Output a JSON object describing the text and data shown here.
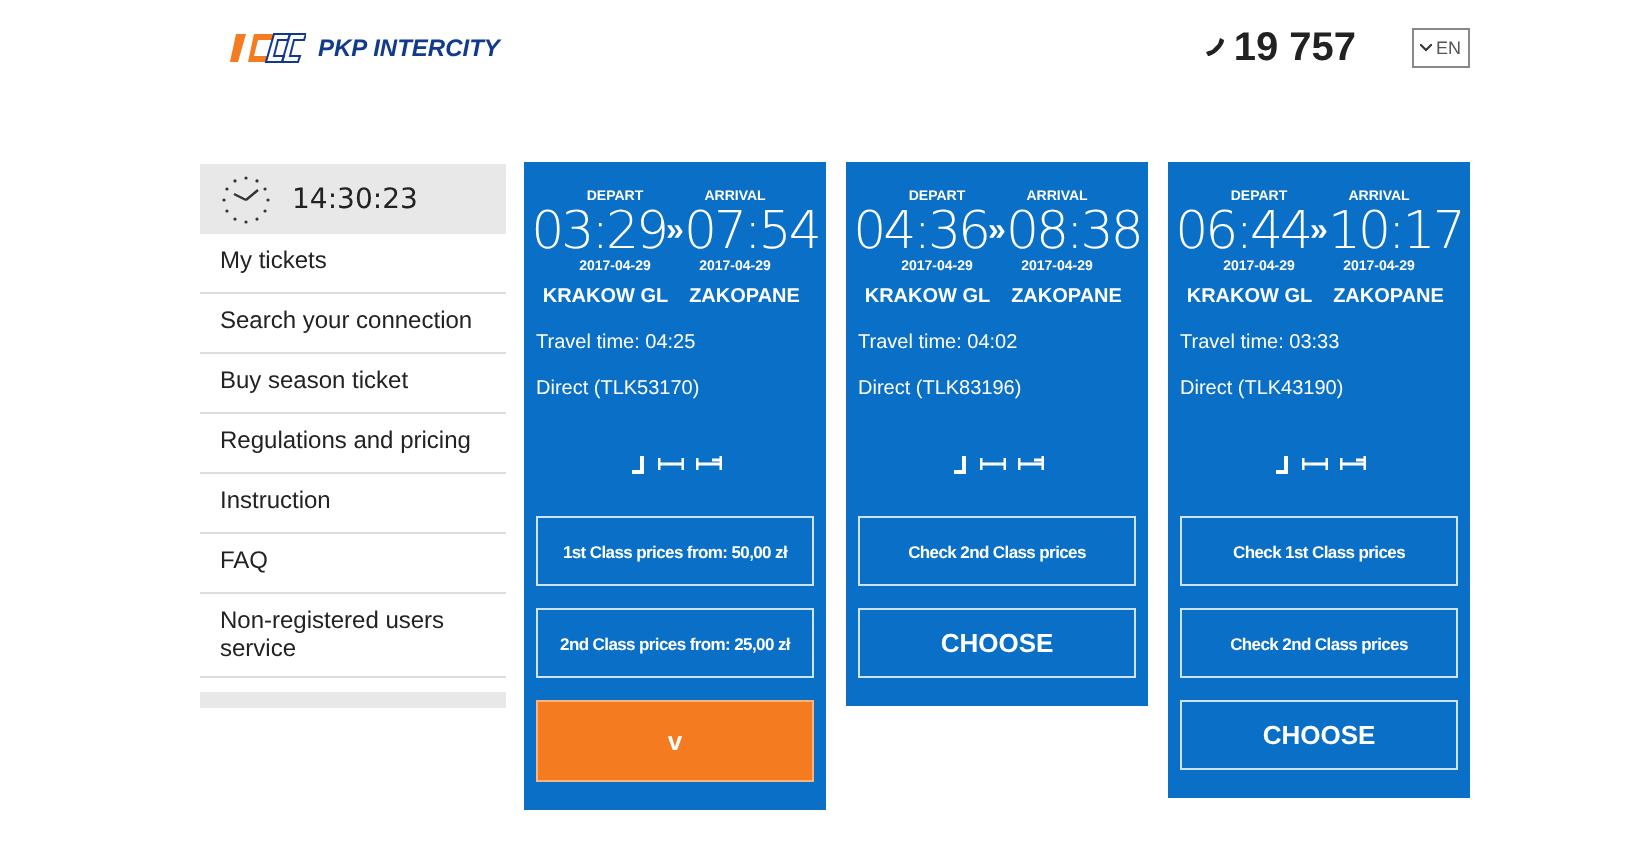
{
  "header": {
    "logo_text": "PKP INTERCITY",
    "phone": "19 757",
    "language": "EN"
  },
  "sidebar": {
    "clock": "14:30:23",
    "items": [
      {
        "label": "My tickets"
      },
      {
        "label": "Search your connection"
      },
      {
        "label": "Buy season ticket"
      },
      {
        "label": "Regulations and pricing"
      },
      {
        "label": "Instruction"
      },
      {
        "label": "FAQ"
      },
      {
        "label": "Non-registered users service"
      }
    ]
  },
  "connections": [
    {
      "depart_label": "DEPART",
      "arrival_label": "ARRIVAL",
      "depart_time": "03:29",
      "separator": "»",
      "arrival_time": "07:54",
      "depart_date": "2017-04-29",
      "arrival_date": "2017-04-29",
      "from": "KRAKOW GL",
      "to": "ZAKOPANE",
      "travel_time": "Travel time: 04:25",
      "train": "Direct (TLK53170)",
      "buttons": [
        {
          "kind": "price",
          "label": "1st Class prices from: 50,00 zł"
        },
        {
          "kind": "price",
          "label": "2nd Class prices from: 25,00 zł"
        },
        {
          "kind": "expand",
          "label": "v"
        }
      ]
    },
    {
      "depart_label": "DEPART",
      "arrival_label": "ARRIVAL",
      "depart_time": "04:36",
      "separator": "»",
      "arrival_time": "08:38",
      "depart_date": "2017-04-29",
      "arrival_date": "2017-04-29",
      "from": "KRAKOW GL",
      "to": "ZAKOPANE",
      "travel_time": "Travel time: 04:02",
      "train": "Direct (TLK83196)",
      "buttons": [
        {
          "kind": "price",
          "label": "Check 2nd Class prices"
        },
        {
          "kind": "choose",
          "label": "CHOOSE"
        }
      ]
    },
    {
      "depart_label": "DEPART",
      "arrival_label": "ARRIVAL",
      "depart_time": "06:44",
      "separator": "»",
      "arrival_time": "10:17",
      "depart_date": "2017-04-29",
      "arrival_date": "2017-04-29",
      "from": "KRAKOW GL",
      "to": "ZAKOPANE",
      "travel_time": "Travel time: 03:33",
      "train": "Direct (TLK43190)",
      "buttons": [
        {
          "kind": "price",
          "label": "Check 1st Class prices"
        },
        {
          "kind": "price",
          "label": "Check 2nd Class prices"
        },
        {
          "kind": "choose",
          "label": "CHOOSE"
        }
      ]
    }
  ]
}
